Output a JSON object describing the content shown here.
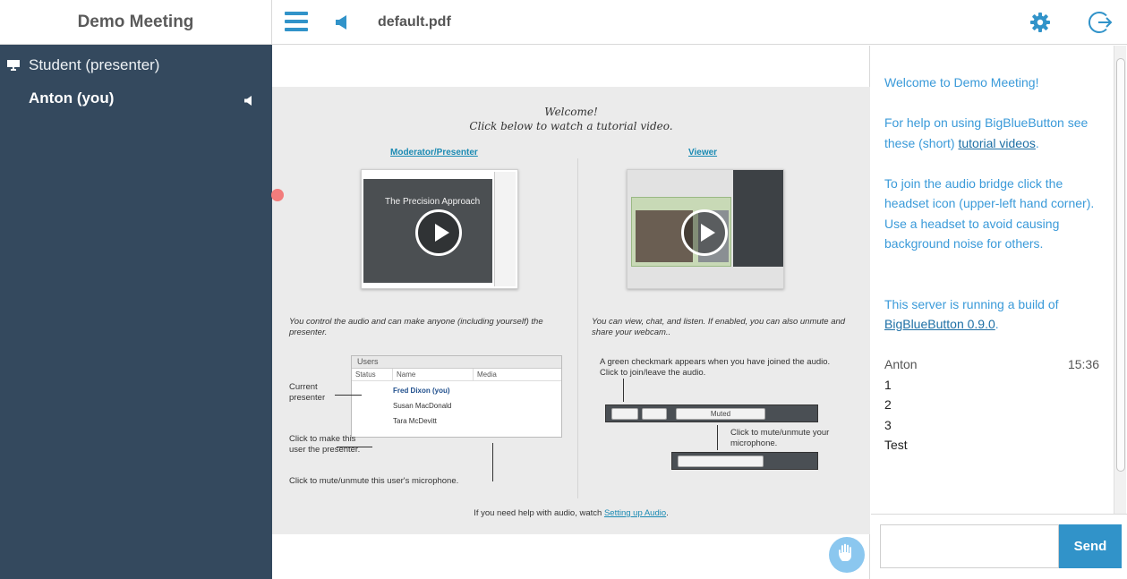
{
  "sidebar": {
    "title": "Demo Meeting",
    "users": [
      {
        "label": "Student (presenter)"
      },
      {
        "label": "Anton (you)"
      }
    ]
  },
  "topbar": {
    "document_title": "default.pdf",
    "icons": {
      "menu": "hamburger-icon",
      "audio": "speaker-icon",
      "settings": "gear-icon",
      "logout": "logout-icon"
    }
  },
  "slide": {
    "welcome_line1": "Welcome!",
    "welcome_line2": "Click below to watch a tutorial video.",
    "moderator_link": "Moderator/Presenter",
    "viewer_link": "Viewer",
    "chalk_title": "The Precision Approach",
    "moderator_desc": "You control the audio and can make anyone (including yourself) the presenter.",
    "viewer_desc": "You can view, chat, and listen.  If enabled, you can also unmute and share your webcam..",
    "users_panel_title": "Users",
    "users_columns": [
      "Status",
      "Name",
      "Media"
    ],
    "users_rows": [
      "Fred Dixon (you)",
      "Susan MacDonald",
      "Tara McDevitt"
    ],
    "current_presenter": "Current presenter",
    "click_make_presenter": "Click to make this user the presenter.",
    "click_mute_user": "Click to mute/unmute this user's microphone.",
    "green_checkmark": "A green checkmark appears when you have joined the audio.  Click to join/leave the audio.",
    "muted_label": "Muted",
    "click_mute_mic": "Click to mute/unmute your microphone.",
    "audio_help_prefix": "If you need help with audio, watch ",
    "audio_help_link": "Setting up Audio",
    "audio_help_suffix": "."
  },
  "chat": {
    "welcome": "Welcome to Demo Meeting!",
    "help_prefix": "For help on using BigBlueButton see these (short) ",
    "help_link": "tutorial videos",
    "help_suffix": ".",
    "audio_instructions": "To join the audio bridge click the headset icon (upper-left hand corner). Use a headset to avoid causing background noise for others.",
    "server_prefix": "This server is running a build of ",
    "server_link": "BigBlueButton 0.9.0",
    "server_suffix": ".",
    "author": "Anton",
    "time": "15:36",
    "messages": [
      "1",
      "2",
      "3",
      "Test"
    ],
    "send_label": "Send",
    "input_value": ""
  },
  "colors": {
    "accent": "#3193c9",
    "sidebar_bg": "#34495e",
    "chat_text": "#3a9ad9"
  }
}
